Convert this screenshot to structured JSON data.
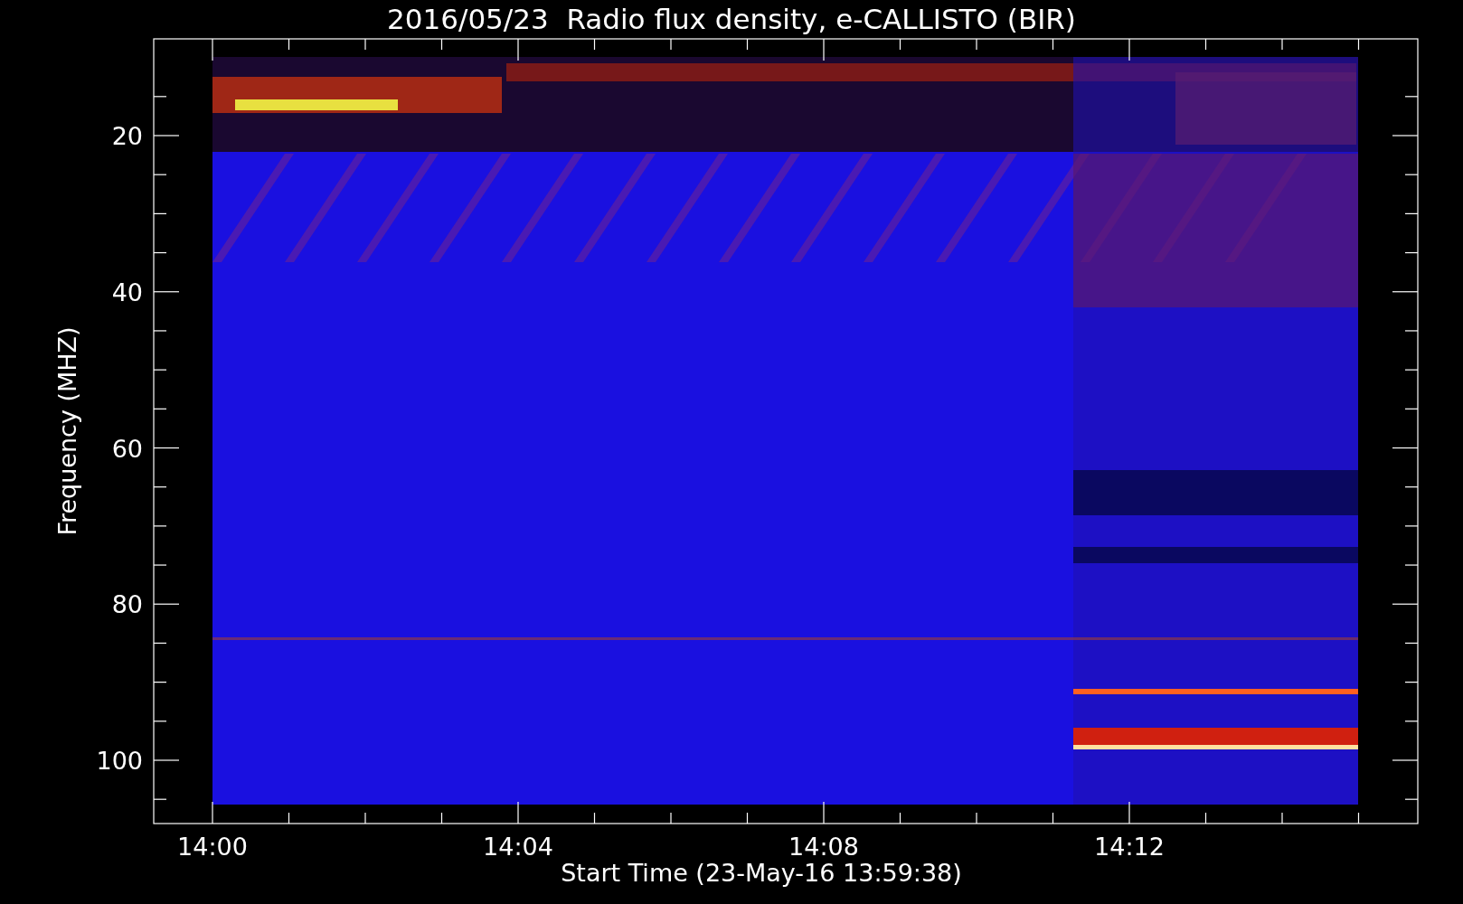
{
  "title": "2016/05/23  Radio flux density, e-CALLISTO (BIR)",
  "ylabel": "Frequency (MHZ)",
  "xlabel": "Start Time (23-May-16 13:59:38)",
  "yticks": [
    "20",
    "40",
    "60",
    "80",
    "100"
  ],
  "xticks": [
    "14:00",
    "14:04",
    "14:08",
    "14:12"
  ]
}
